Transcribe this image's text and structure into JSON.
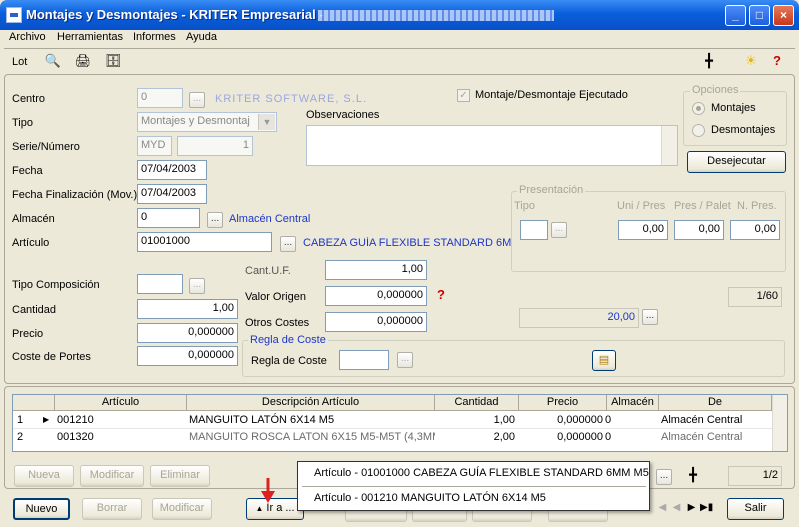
{
  "window": {
    "title": "Montajes y Desmontajes - KRITER Empresarial - ",
    "title_blurred": "[ACSOL SERVICIOS INFORMATICOS, S.L.]",
    "controls": [
      "_",
      "□",
      "×"
    ]
  },
  "menu": [
    "Archivo",
    "Herramientas",
    "Informes",
    "Ayuda"
  ],
  "toolbar": {
    "lot_label": "Lot"
  },
  "form": {
    "centro": {
      "label": "Centro",
      "value": "0",
      "description": "KRITER SOFTWARE, S.L."
    },
    "tipo": {
      "label": "Tipo",
      "value": "Montajes y Desmontaj"
    },
    "serie": {
      "label": "Serie/Número",
      "serie": "MYD",
      "numero": "1"
    },
    "fecha": {
      "label": "Fecha",
      "value": "07/04/2003"
    },
    "fecha_fin": {
      "label": "Fecha Finalización (Mov.)",
      "value": "07/04/2003"
    },
    "almacen": {
      "label": "Almacén",
      "value": "0",
      "description": "Almacén Central"
    },
    "articulo": {
      "label": "Artículo",
      "value": "01001000",
      "description": "CABEZA GUÍA FLEXIBLE STANDARD 6MM"
    },
    "tipo_composicion": {
      "label": "Tipo Composición",
      "value": ""
    },
    "cantidad": {
      "label": "Cantidad",
      "value": "1,00"
    },
    "precio": {
      "label": "Precio",
      "value": "0,000000"
    },
    "coste_portes": {
      "label": "Coste de Portes",
      "value": "0,000000"
    },
    "cant_uf": {
      "label": "Cant.U.F.",
      "value": "1,00"
    },
    "valor_origen": {
      "label": "Valor Origen",
      "value": "0,000000"
    },
    "otros_costes": {
      "label": "Otros Costes",
      "value": "0,000000"
    },
    "regla_coste_group": "Regla de Coste",
    "regla_coste": {
      "label": "Regla de Coste",
      "value": ""
    },
    "ejecutado": {
      "label": "Montaje/Desmontaje Ejecutado",
      "checked": true
    },
    "observaciones": {
      "label": "Observaciones",
      "value": ""
    },
    "opciones": {
      "caption": "Opciones",
      "options": [
        "Montajes",
        "Desmontajes"
      ],
      "selected": "Montajes"
    },
    "desejecutar": "Desejecutar",
    "presentacion": {
      "caption": "Presentación",
      "tipo_label": "Tipo",
      "uni_label": "Uni / Pres",
      "uni_value": "0,00",
      "pres_label": "Pres / Palet",
      "pres_value": "0,00",
      "npres_label": "N. Pres.",
      "npres_value": "0,00"
    },
    "page_counter": "1/60",
    "total_value": "20,00"
  },
  "grid": {
    "columns": [
      "Artículo",
      "Descripción Artículo",
      "Cantidad",
      "Precio",
      "Almacén",
      "De"
    ],
    "rows": [
      {
        "num": "1",
        "articulo": "001210",
        "descripcion": "MANGUITO LATÓN 6X14 M5",
        "cantidad": "1,00",
        "precio": "0,000000",
        "almacen_code": "0",
        "almacen": "Almacén Central"
      },
      {
        "num": "2",
        "articulo": "001320",
        "descripcion": "MANGUITO ROSCA LATON 6X15 M5-M5T (4,3MM",
        "cantidad": "2,00",
        "precio": "0,000000",
        "almacen_code": "0",
        "almacen": "Almacén Central"
      }
    ],
    "buttons": {
      "nueva": "Nueva",
      "modificar": "Modificar",
      "eliminar": "Eliminar"
    },
    "page_counter": "1/2"
  },
  "bottom": {
    "nuevo": "Nuevo",
    "borrar": "Borrar",
    "modificar": "Modificar",
    "ira": "Ir a ...",
    "salir": "Salir"
  },
  "popup": {
    "items": [
      "Artículo - 01001000 CABEZA GUÍA FLEXIBLE STANDARD 6MM M5",
      "Artículo - 001210 MANGUITO LATÓN 6X14 M5"
    ]
  },
  "colors": {
    "accent_blue": "#1d36c8",
    "title_blue": "#0A5FDB",
    "arrow_red": "#e02020"
  }
}
